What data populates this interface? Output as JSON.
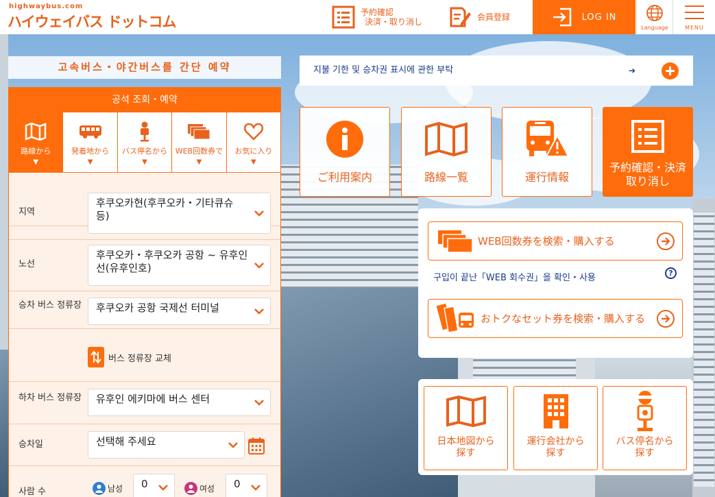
{
  "header": {
    "logo_url_text": "highwaybus.com",
    "logo_text": "ハイウェイバス ドットコム",
    "reservation_line1": "予約確認",
    "reservation_line2": "決済・取り消し",
    "member_label": "会員登録",
    "login_label": "LOG IN",
    "language_label": "Language",
    "menu_label": "MENU"
  },
  "left": {
    "banner": "고속버스・야간버스를 간단 예약",
    "panel_title": "공석 조회・예약",
    "tabs": [
      {
        "label": "路線から",
        "icon": "map-icon",
        "active": true
      },
      {
        "label": "発着地から",
        "icon": "bus-icon",
        "active": false
      },
      {
        "label": "バス停名から",
        "icon": "bus-stop-icon",
        "active": false
      },
      {
        "label": "WEB回数券で",
        "icon": "tickets-icon",
        "active": false
      },
      {
        "label": "お気に入り",
        "icon": "heart-icon",
        "active": false
      }
    ],
    "tab_arrow": "▼",
    "fields": {
      "region_label": "지역",
      "region_value": "후쿠오카현(후쿠오카・기타큐슈 등)",
      "route_label": "노선",
      "route_value": "후쿠오카・후쿠오카 공항 ~ 유후인선(유후인호)",
      "board_label": "승차 버스 정류장",
      "board_value": "후쿠오카 공항 국제선 터미널",
      "swap_label": "버스 정류장 교체",
      "alight_label": "하차 버스 정류장",
      "alight_value": "유후인 에키마에 버스 센터",
      "date_label": "승차일",
      "date_value": "선택해 주세요",
      "people_label": "사람 수",
      "male_label": "남성",
      "male_value": "0",
      "female_label": "여성",
      "female_value": "0"
    }
  },
  "right": {
    "notice": "지불 기한 및 승차권 표시에 관한 부탁",
    "notice_arrow": "➔",
    "tiles": [
      {
        "line1": "ご利用案内",
        "line2": "",
        "icon": "info-icon"
      },
      {
        "line1": "路線一覧",
        "line2": "",
        "icon": "map-icon"
      },
      {
        "line1": "運行情報",
        "line2": "",
        "icon": "bus-warning-icon"
      },
      {
        "line1": "予約確認・決済",
        "line2": "取り消し",
        "icon": "list-icon"
      }
    ],
    "web_ticket_button": "WEB回数券を検索・購入する",
    "web_ticket_link": "구입이 끝난「WEB 회수권」을 확인・사용",
    "set_ticket_button": "おトクなセット券を検索・購入する",
    "help_mark": "?",
    "search_tiles": [
      {
        "line1": "日本地図から",
        "line2": "探す",
        "icon": "japan-map-icon"
      },
      {
        "line1": "運行会社から",
        "line2": "探す",
        "icon": "building-icon"
      },
      {
        "line1": "バス停名から",
        "line2": "探す",
        "icon": "bus-stop-icon"
      }
    ]
  },
  "colors": {
    "brand_orange": "#ff6c0c",
    "link_blue": "#1a3a8c",
    "form_bg": "#fdf1e8"
  }
}
